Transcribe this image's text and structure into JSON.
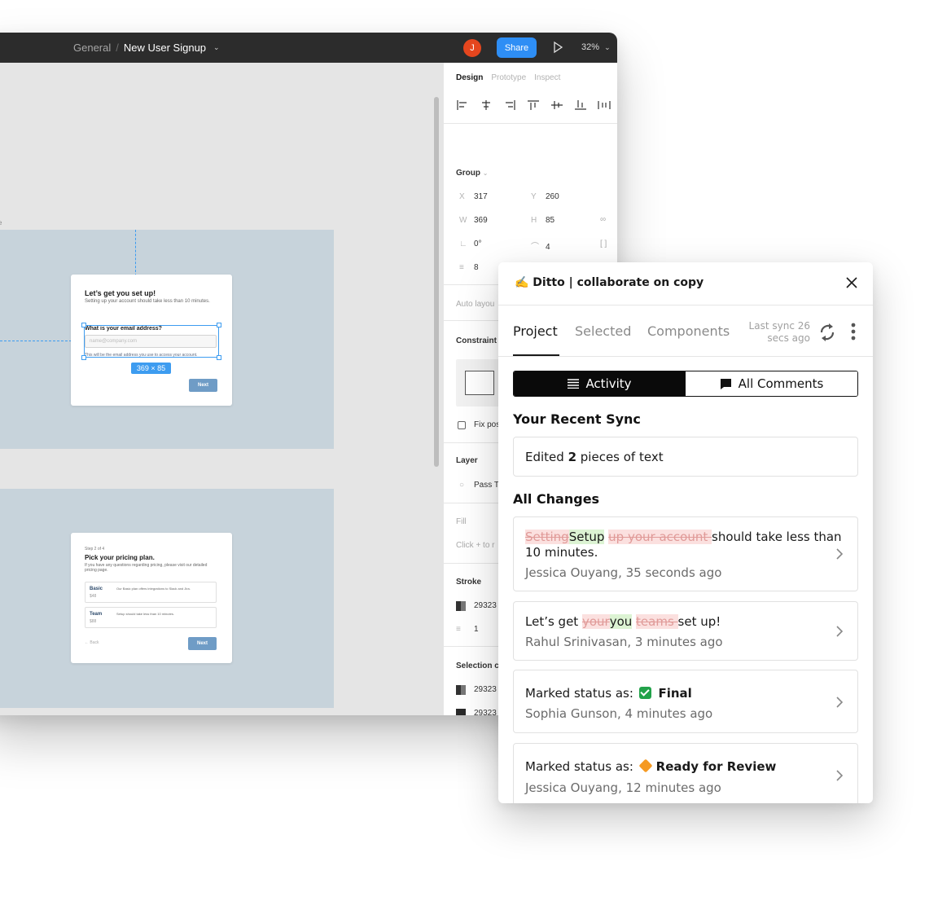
{
  "figma": {
    "breadcrumb": {
      "parent": "General",
      "separator": "/",
      "current": "New User Signup"
    },
    "avatar_initial": "J",
    "share_label": "Share",
    "zoom": "32%",
    "canvas": {
      "frame_tag": "e",
      "card1": {
        "title": "Let’s get you set up!",
        "subtitle": "Setting up your account should take less than 10 minutes.",
        "field_label": "What is your email address?",
        "input_placeholder": "name@company.com",
        "help_text": "This will be the email address you use to access your account.",
        "next_label": "Next",
        "dimensions": "369 × 85"
      },
      "card2": {
        "step": "Step 2 of 4",
        "title": "Pick your pricing plan.",
        "subtitle": "If you have any questions regarding pricing, please visit our detailed pricing page.",
        "plans": [
          {
            "name": "Basic",
            "price": "$48",
            "desc": "Our Basic plan offers integrations to Slack and Jira."
          },
          {
            "name": "Team",
            "price": "$88",
            "desc": "Setup should take less than 10 minutes."
          }
        ],
        "back_label": "← Back",
        "next_label": "Next"
      }
    },
    "panel": {
      "tabs": [
        "Design",
        "Prototype",
        "Inspect"
      ],
      "group_label": "Group",
      "x_key": "X",
      "x": "317",
      "y_key": "Y",
      "y": "260",
      "w_key": "W",
      "w": "369",
      "h_key": "H",
      "h": "85",
      "rotation": "0°",
      "radius": "4",
      "spacing": "8",
      "auto_layout": "Auto layou",
      "constraints": "Constraint",
      "fix_position": "Fix pos",
      "layer": "Layer",
      "layer_mode": "Pass T",
      "fill": "Fill",
      "fill_hint": "Click + to r",
      "stroke": "Stroke",
      "stroke_color": "29323",
      "stroke_weight": "1",
      "selection_colors": "Selection c",
      "selection_values": [
        "29323",
        "29323",
        "29323"
      ]
    }
  },
  "ditto": {
    "title": "✍️ Ditto | collaborate on copy",
    "tabs": [
      "Project",
      "Selected",
      "Components"
    ],
    "last_sync": "Last sync 26 secs ago",
    "toggle": {
      "activity": "Activity",
      "comments": "All Comments"
    },
    "recent_sync_heading": "Your Recent Sync",
    "recent_sync": {
      "prefix": "Edited ",
      "count": "2",
      "suffix": " pieces of text"
    },
    "all_changes_heading": "All Changes",
    "changes": [
      {
        "deleted1": "Setting",
        "inserted1": "Setup",
        "deleted2": "up your account ",
        "rest": "should take less than",
        "line2": "10 minutes.",
        "meta": "Jessica Ouyang, 35 seconds ago"
      },
      {
        "text1": "Let’s get ",
        "deleted1": "your",
        "inserted1": "you",
        "space": " ",
        "deleted2": "teams ",
        "rest": "set up!",
        "meta": "Rahul Srinivasan, 3 minutes ago"
      },
      {
        "prefix": "Marked status as:",
        "status": "Final",
        "meta": "Sophia Gunson, 4 minutes ago"
      },
      {
        "prefix": "Marked status as:",
        "status": "Ready for Review",
        "meta": "Jessica Ouyang, 12 minutes ago"
      }
    ]
  }
}
